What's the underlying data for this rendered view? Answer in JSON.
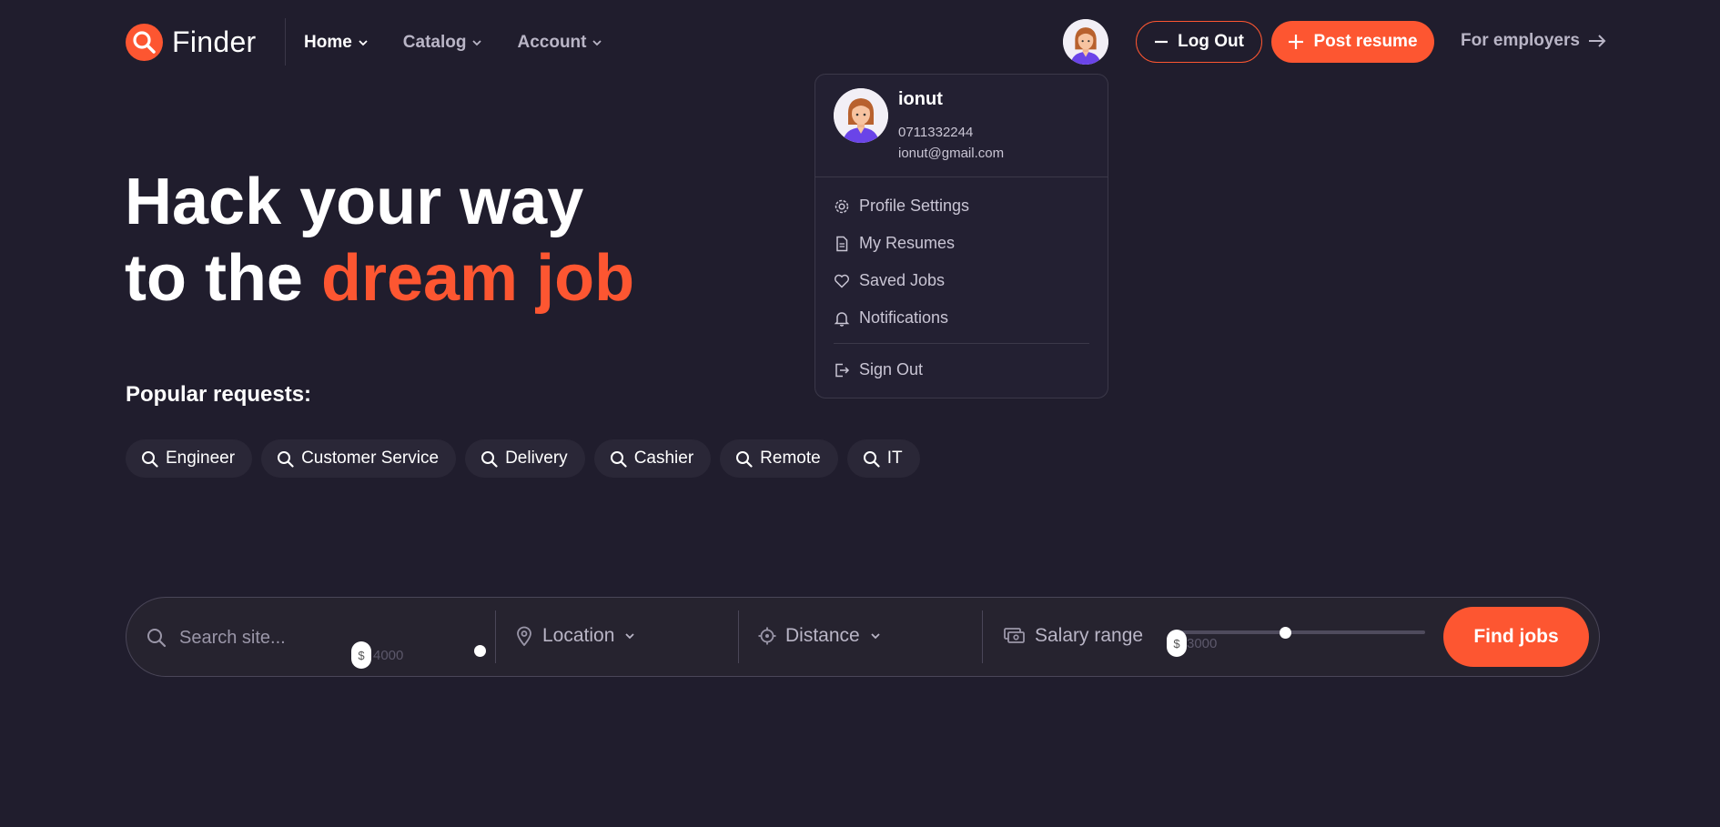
{
  "header": {
    "logo_text": "Finder",
    "nav": [
      {
        "label": "Home"
      },
      {
        "label": "Catalog"
      },
      {
        "label": "Account"
      }
    ],
    "logout_label": "Log Out",
    "post_resume_label": "Post resume",
    "employers_label": "For employers"
  },
  "dropdown": {
    "name": "ionut",
    "phone": "0711332244",
    "email": "ionut@gmail.com",
    "items": [
      {
        "label": "Profile Settings",
        "icon": "gear-icon"
      },
      {
        "label": "My Resumes",
        "icon": "file-icon"
      },
      {
        "label": "Saved Jobs",
        "icon": "heart-icon"
      },
      {
        "label": "Notifications",
        "icon": "bell-icon"
      }
    ],
    "signout_label": "Sign Out"
  },
  "hero": {
    "line1": "Hack your way",
    "line2_prefix": "to the ",
    "line2_accent": "dream job"
  },
  "popular": {
    "title": "Popular requests:",
    "tags": [
      "Engineer",
      "Customer Service",
      "Delivery",
      "Cashier",
      "Remote",
      "IT"
    ]
  },
  "search": {
    "placeholder": "Search site...",
    "slider_handle_text": "$",
    "slider_faint_text": "4000",
    "location_label": "Location",
    "distance_label": "Distance",
    "salary_label": "Salary range",
    "salary_handle_text": "$",
    "salary_faint_text": "3000",
    "find_label": "Find jobs"
  },
  "colors": {
    "background": "#201d2d",
    "accent": "#fd5631"
  }
}
